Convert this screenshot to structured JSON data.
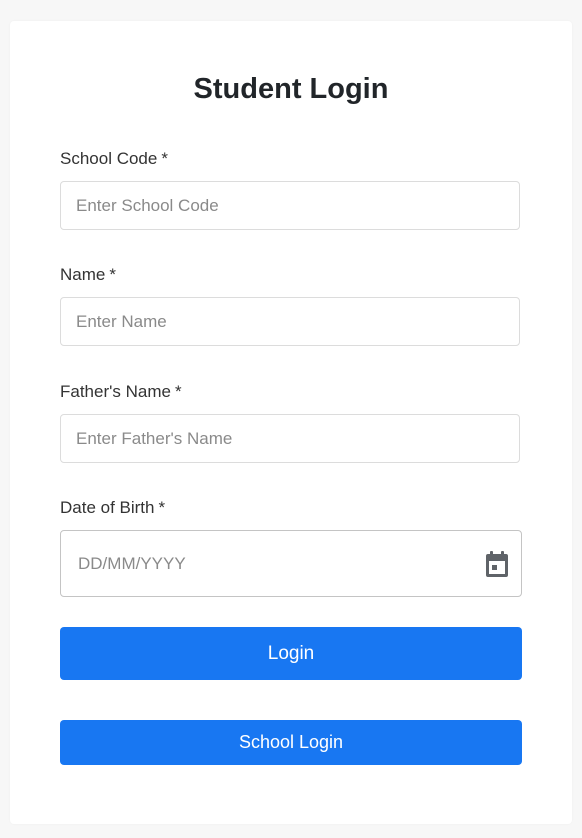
{
  "form": {
    "title": "Student Login",
    "fields": [
      {
        "label": "School Code",
        "required_mark": "*",
        "placeholder": "Enter School Code",
        "value": ""
      },
      {
        "label": "Name",
        "required_mark": "*",
        "placeholder": "Enter Name",
        "value": ""
      },
      {
        "label": "Father's Name",
        "required_mark": "*",
        "placeholder": "Enter Father's Name",
        "value": ""
      }
    ],
    "dob": {
      "label": "Date of Birth",
      "required_mark": "*",
      "placeholder": "DD/MM/YYYY",
      "icon": "calendar-icon"
    },
    "login_button": "Login",
    "school_login_button": "School Login"
  },
  "colors": {
    "primary": "#1877f2",
    "background": "#f7f7f7",
    "card": "#ffffff",
    "text": "#333333",
    "icon": "#5f6368"
  }
}
